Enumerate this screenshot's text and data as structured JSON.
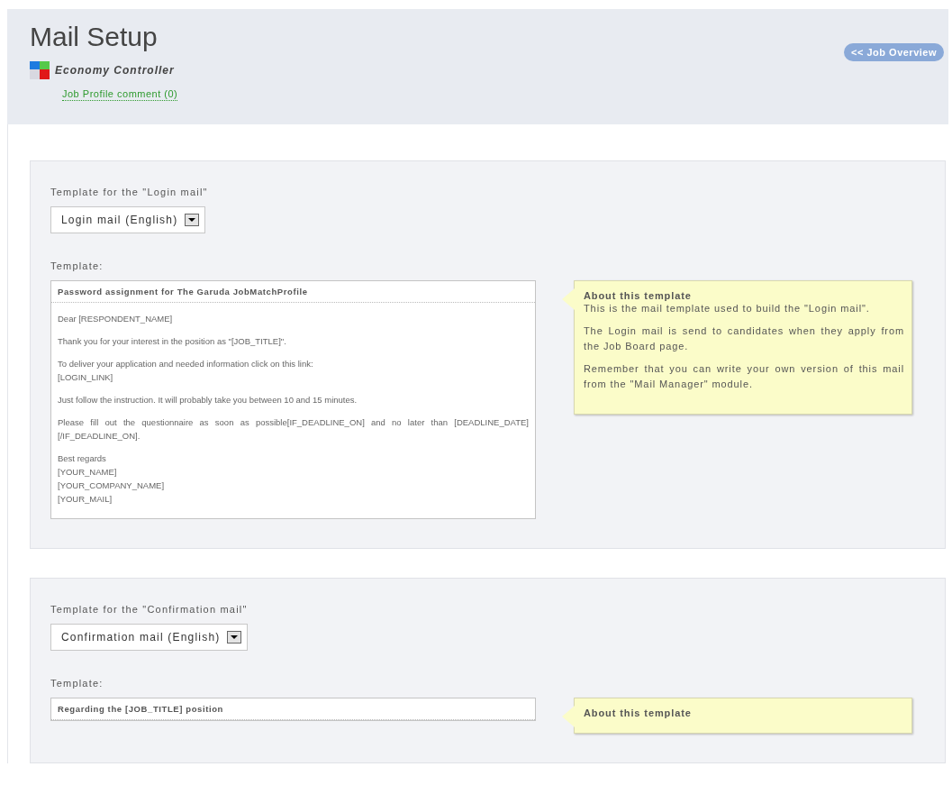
{
  "header": {
    "title": "Mail Setup",
    "subtitle": "Economy Controller",
    "comment_link": "Job Profile comment (0)",
    "overview_button": "<< Job Overview"
  },
  "sections": [
    {
      "label": "Template for the \"Login mail\"",
      "select_value": "Login mail (English)",
      "template_label": "Template:",
      "subject": "Password assignment for The Garuda JobMatchProfile",
      "body": [
        [
          "Dear [RESPONDENT_NAME]"
        ],
        [
          "Thank you for your interest in the position as \"[JOB_TITLE]\"."
        ],
        [
          "To deliver your application and needed information click on this link:",
          "[LOGIN_LINK]"
        ],
        [
          "Just follow the instruction. It will probably take you between 10 and 15 minutes."
        ],
        [
          "Please fill out the questionnaire as soon as possible[IF_DEADLINE_ON] and no later than [DEADLINE_DATE][/IF_DEADLINE_ON]."
        ],
        [
          "Best regards",
          "[YOUR_NAME]",
          "[YOUR_COMPANY_NAME]",
          "[YOUR_MAIL]"
        ]
      ],
      "tip": {
        "title": "About this template",
        "paragraphs": [
          "This is the mail template used to build the \"Login mail\".",
          "The Login mail is send to candidates when they apply from the Job Board page.",
          "Remember that you can write your own version of this mail from the \"Mail Manager\" module."
        ]
      }
    },
    {
      "label": "Template for the \"Confirmation mail\"",
      "select_value": "Confirmation mail (English)",
      "template_label": "Template:",
      "subject": "Regarding the [JOB_TITLE] position",
      "tip": {
        "title": "About this template"
      }
    }
  ]
}
